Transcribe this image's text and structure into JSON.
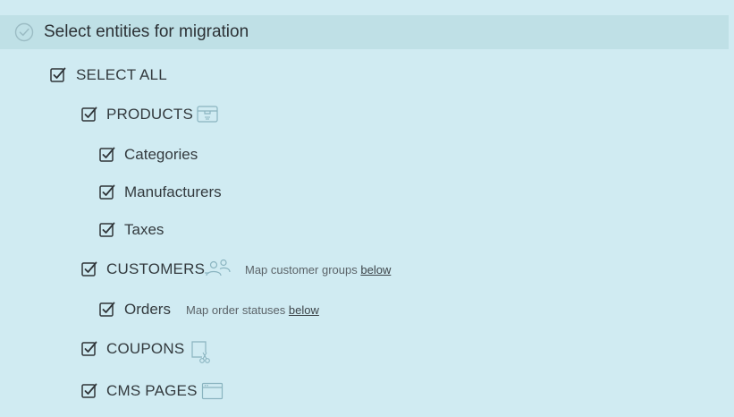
{
  "header": {
    "title": "Select entities for migration",
    "icon": "check-circle-icon"
  },
  "entities": {
    "select_all": {
      "label": "SELECT ALL",
      "checked": true
    },
    "products": {
      "label": "PRODUCTS",
      "checked": true,
      "icon": "box-icon"
    },
    "categories": {
      "label": "Categories",
      "checked": true
    },
    "manufacturers": {
      "label": "Manufacturers",
      "checked": true
    },
    "taxes": {
      "label": "Taxes",
      "checked": true
    },
    "customers": {
      "label": "CUSTOMERS",
      "checked": true,
      "icon": "users-icon",
      "note": "Map customer groups",
      "link": "below"
    },
    "orders": {
      "label": "Orders",
      "checked": true,
      "note": "Map order statuses",
      "link": "below"
    },
    "coupons": {
      "label": "COUPONS",
      "checked": true,
      "icon": "coupon-scissors-icon"
    },
    "cms_pages": {
      "label": "CMS PAGES",
      "checked": true,
      "icon": "browser-window-icon"
    }
  },
  "colors": {
    "background": "#d0ebf2",
    "header_background": "#bfe0e6",
    "icon_tint": "#8ab4c0",
    "text": "#333a3e"
  }
}
